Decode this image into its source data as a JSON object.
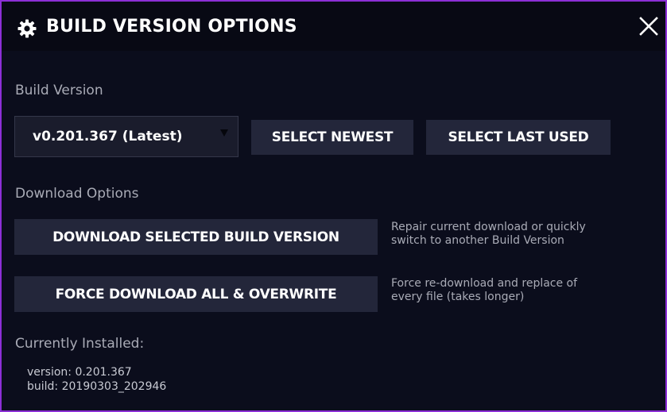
{
  "dialog": {
    "title": "BUILD VERSION OPTIONS",
    "icons": {
      "title": "gear-icon",
      "close": "close-icon"
    },
    "colors": {
      "frame": "#8c2fd6",
      "background": "#0b0d1c",
      "button": "#23263a"
    }
  },
  "build_version": {
    "label": "Build Version",
    "selected": "v0.201.367 (Latest)",
    "select_newest_label": "SELECT NEWEST",
    "select_last_used_label": "SELECT LAST USED"
  },
  "download_options": {
    "label": "Download Options",
    "download_selected_label": "DOWNLOAD SELECTED BUILD VERSION",
    "download_selected_desc_line1": "Repair current download or quickly",
    "download_selected_desc_line2": "switch to another Build Version",
    "force_download_label": "FORCE DOWNLOAD ALL & OVERWRITE",
    "force_download_desc_line1": "Force re-download and replace of",
    "force_download_desc_line2": "every file (takes longer)"
  },
  "installed": {
    "label": "Currently Installed:",
    "version_line": "version: 0.201.367",
    "build_line": "build: 20190303_202946"
  }
}
